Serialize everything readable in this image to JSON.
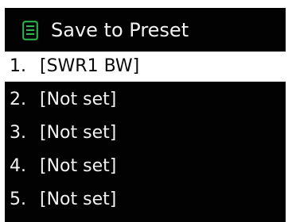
{
  "header": {
    "icon": "list-menu-icon",
    "title": "Save to Preset"
  },
  "presets": [
    {
      "number": "1.",
      "value": "[SWR1 BW]",
      "selected": true
    },
    {
      "number": "2.",
      "value": "[Not set]",
      "selected": false
    },
    {
      "number": "3.",
      "value": "[Not set]",
      "selected": false
    },
    {
      "number": "4.",
      "value": "[Not set]",
      "selected": false
    },
    {
      "number": "5.",
      "value": "[Not set]",
      "selected": false
    }
  ],
  "colors": {
    "screen_background": "#020202",
    "text": "#f2f2f2",
    "selection_background": "#ffffff",
    "selection_text": "#080808",
    "icon_accent": "#2fb84f"
  }
}
